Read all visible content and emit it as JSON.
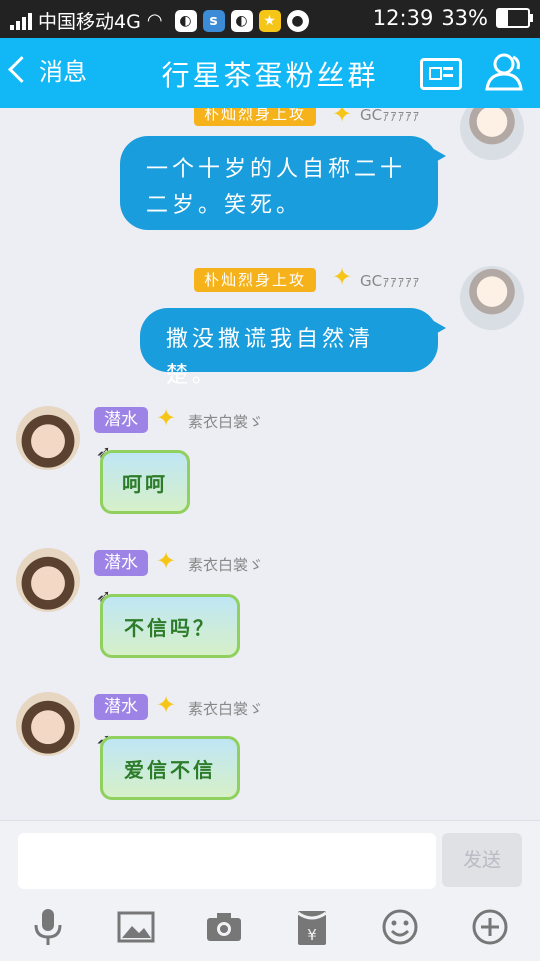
{
  "status_bar": {
    "carrier": "中国移动4G",
    "time": "12:39",
    "battery_text": "33%",
    "battery_level": 0.33,
    "icons": [
      "signal-icon",
      "wifi-icon",
      "weibo-icon",
      "app-icon",
      "weibo-icon",
      "star-app-icon",
      "notification-icon"
    ]
  },
  "header": {
    "back_label": "消息",
    "title": "行星茶蛋粉丝群",
    "background": "#12b7f5"
  },
  "messages": [
    {
      "side": "right",
      "badge": "朴灿烈身上攻",
      "nickname": "GCｧｧｧｧｧ",
      "text": "一个十岁的人自称二十二岁。笑死。"
    },
    {
      "side": "right",
      "badge": "朴灿烈身上攻",
      "nickname": "GCｧｧｧｧｧ",
      "text": "撒没撒谎我自然清楚。"
    },
    {
      "side": "left",
      "badge": "潜水",
      "nickname": "素衣白裳ゞ",
      "sticker": "呵呵"
    },
    {
      "side": "left",
      "badge": "潜水",
      "nickname": "素衣白裳ゞ",
      "sticker": "不信吗？"
    },
    {
      "side": "left",
      "badge": "潜水",
      "nickname": "素衣白裳ゞ",
      "sticker": "爱信不信"
    }
  ],
  "composer": {
    "input_value": "",
    "send_label": "发送",
    "tools": [
      "microphone-icon",
      "image-icon",
      "camera-icon",
      "red-packet-icon",
      "emoji-icon",
      "plus-icon"
    ]
  },
  "colors": {
    "bubble": "#1a9ddc",
    "title_badge": "#f5b21b",
    "level_badge": "#9d83e6",
    "chat_bg": "#eceef3"
  }
}
